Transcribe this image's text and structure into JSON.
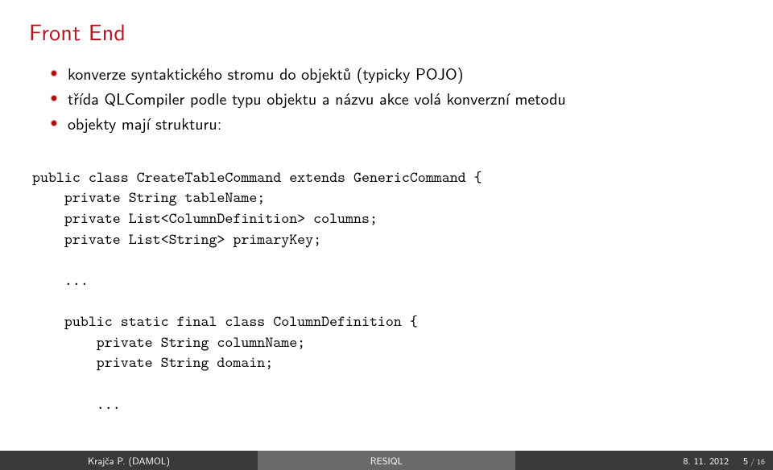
{
  "title": "Front End",
  "bullets": [
    "konverze syntaktického stromu do objektů (typicky POJO)",
    "třída QLCompiler podle typu objektu a názvu akce volá konverzní metodu",
    "objekty mají strukturu:"
  ],
  "code": {
    "line1": "public class CreateTableCommand extends GenericCommand {",
    "line2": "    private String tableName;",
    "line3": "    private List<ColumnDefinition> columns;",
    "line4": "    private List<String> primaryKey;",
    "blank1": "",
    "dots1": "    ...",
    "blank2": "",
    "line5": "    public static final class ColumnDefinition {",
    "line6": "        private String columnName;",
    "line7": "        private String domain;",
    "blank3": "",
    "dots2": "        ..."
  },
  "footer": {
    "author": "Krajča P. (DAMOL)",
    "title_short": "RESIQL",
    "date": "8. 11. 2012",
    "page_current": "5",
    "page_sep": "/",
    "page_total": "16"
  },
  "colors": {
    "accent": "#b7141e",
    "footer_dark": "#3a3a3a",
    "footer_mid": "#6a6a6a"
  }
}
